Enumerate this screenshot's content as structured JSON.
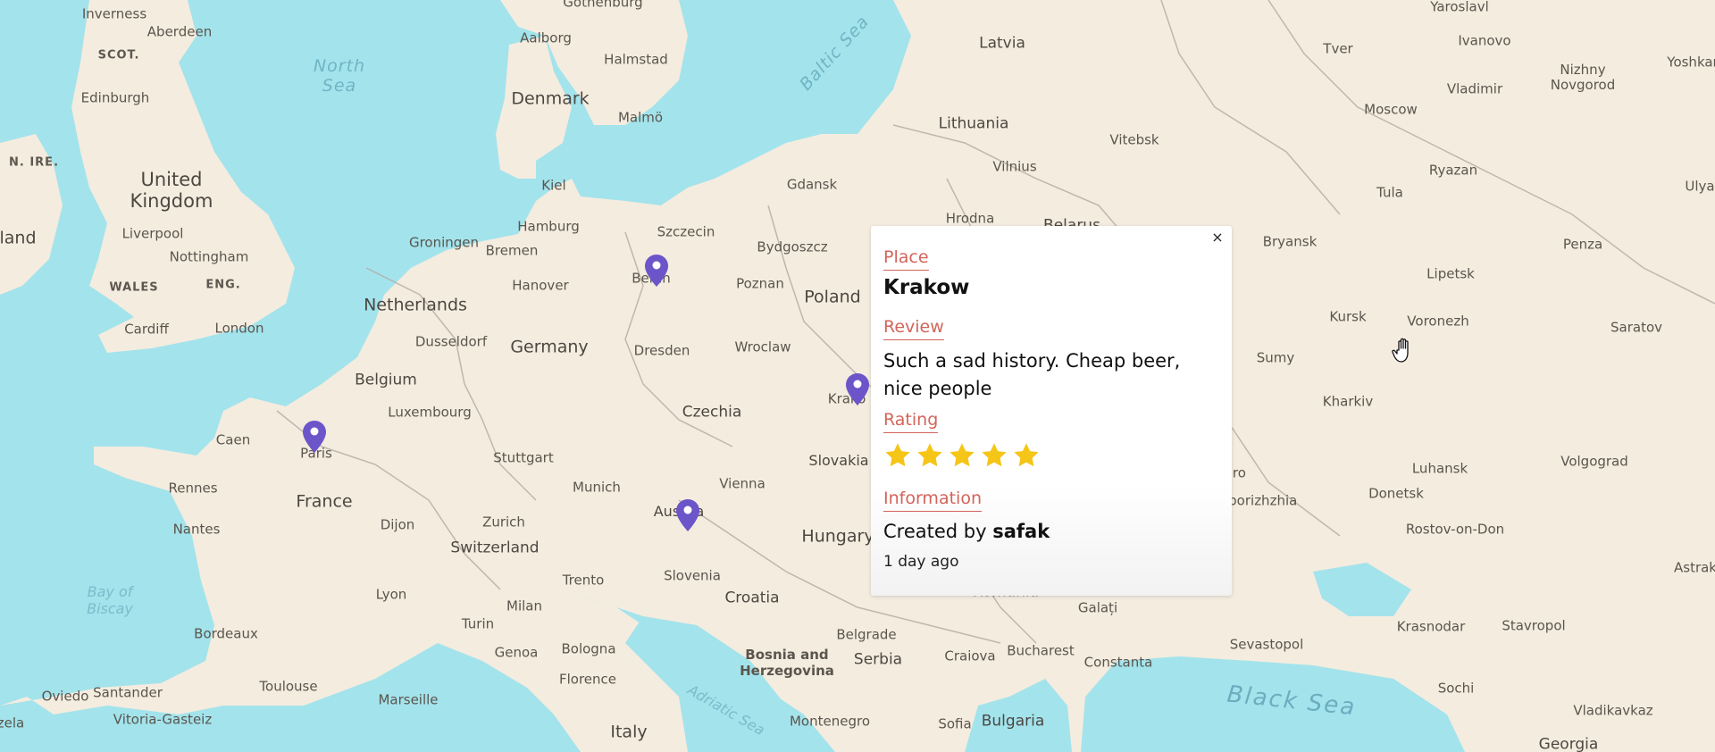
{
  "map": {
    "labels": {
      "inverness": "Inverness",
      "aberdeen": "Aberdeen",
      "scot": "SCOT.",
      "north_sea": "North\nSea",
      "edinburgh": "Edinburgh",
      "n_ire": "N. IRE.",
      "ireland": "land",
      "united_kingdom": "United\nKingdom",
      "liverpool": "Liverpool",
      "nottingham": "Nottingham",
      "wales": "WALES",
      "eng": "ENG.",
      "cardiff": "Cardiff",
      "london": "London",
      "gothenburg": "Gothenburg",
      "aalborg": "Aalborg",
      "halmstad": "Halmstad",
      "denmark": "Denmark",
      "malmo": "Malmö",
      "baltic_sea": "Baltic Sea",
      "kiel": "Kiel",
      "hamburg": "Hamburg",
      "groningen": "Groningen",
      "bremen": "Bremen",
      "szczecin": "Szczecin",
      "berlin": "Berlin",
      "netherlands": "Netherlands",
      "hanover": "Hanover",
      "dusseldorf": "Dusseldorf",
      "germany": "Germany",
      "belgium": "Belgium",
      "luxembourg": "Luxembourg",
      "dresden": "Dresden",
      "caen": "Caen",
      "paris": "Paris",
      "rennes": "Rennes",
      "france": "France",
      "nantes": "Nantes",
      "dijon": "Dijon",
      "stuttgart": "Stuttgart",
      "munich": "Munich",
      "zurich": "Zurich",
      "switzerland": "Switzerland",
      "lyon": "Lyon",
      "bay_of_biscay": "Bay of\nBiscay",
      "bordeaux": "Bordeaux",
      "milan": "Milan",
      "turin": "Turin",
      "genoa": "Genoa",
      "trento": "Trento",
      "bologna": "Bologna",
      "florence": "Florence",
      "toulouse": "Toulouse",
      "marseille": "Marseille",
      "oviedo": "Oviedo",
      "santander": "Santander",
      "vitoria": "Vitoria-Gasteiz",
      "zela": "zela",
      "italy": "Italy",
      "latvia": "Latvia",
      "lithuania": "Lithuania",
      "vilnius": "Vilnius",
      "gdansk": "Gdansk",
      "bydgoszcz": "Bydgoszcz",
      "poznan": "Poznan",
      "poland": "Poland",
      "wroclaw": "Wroclaw",
      "czechia": "Czechia",
      "krakow": "Krako",
      "vienna": "Vienna",
      "slovakia": "Slovakia",
      "austria": "Austria",
      "hungary": "Hungary",
      "slovenia": "Slovenia",
      "croatia": "Croatia",
      "romania": "Romania",
      "bosnia": "Bosnia and\nHerzegovina",
      "serbia": "Serbia",
      "belgrade": "Belgrade",
      "craiova": "Craiova",
      "bucharest": "Bucharest",
      "constanta": "Constanta",
      "galati": "Galați",
      "montenegro": "Montenegro",
      "sofia": "Sofia",
      "bulgaria": "Bulgaria",
      "adriatic_sea": "Adriatic Sea",
      "hrodna": "Hrodna",
      "belarus": "Belarus",
      "vitebsk": "Vitebsk",
      "yaroslavl": "Yaroslavl",
      "tver": "Tver",
      "ivanovo": "Ivanovo",
      "nizhny": "Nizhny\nNovgorod",
      "vladimir": "Vladimir",
      "moscow": "Moscow",
      "ryazan": "Ryazan",
      "tula": "Tula",
      "bryansk": "Bryansk",
      "lipetsk": "Lipetsk",
      "penza": "Penza",
      "kursk": "Kursk",
      "voronezh": "Voronezh",
      "sumy": "Sumy",
      "saratov": "Saratov",
      "kharkiv": "Kharkiv",
      "volgograd": "Volgograd",
      "dnipro": "Dnipro",
      "luhansk": "Luhansk",
      "donetsk": "Donetsk",
      "zaporizhzhia": "Zaporizhzhia",
      "rostov": "Rostov-on-Don",
      "sevastopol": "Sevastopol",
      "krasnodar": "Krasnodar",
      "stavropol": "Stavropol",
      "sochi": "Sochi",
      "black_sea": "Black Sea",
      "vladikavkaz": "Vladikavkaz",
      "georgia": "Georgia",
      "astrak": "Astrak",
      "ulya": "Ulya",
      "yoshkar": "Yoshkar"
    },
    "marker_color": "#6b55c9"
  },
  "popup": {
    "place_label": "Place",
    "place_name": "Krakow",
    "review_label": "Review",
    "review_text": "Such a sad history. Cheap beer, nice people",
    "rating_label": "Rating",
    "rating": 5,
    "max_rating": 5,
    "information_label": "Information",
    "created_prefix": "Created by",
    "created_user": "safak",
    "time_ago": "1 day ago",
    "close_symbol": "×",
    "accent_color": "#d3645a",
    "star_color": "#f5c518"
  }
}
